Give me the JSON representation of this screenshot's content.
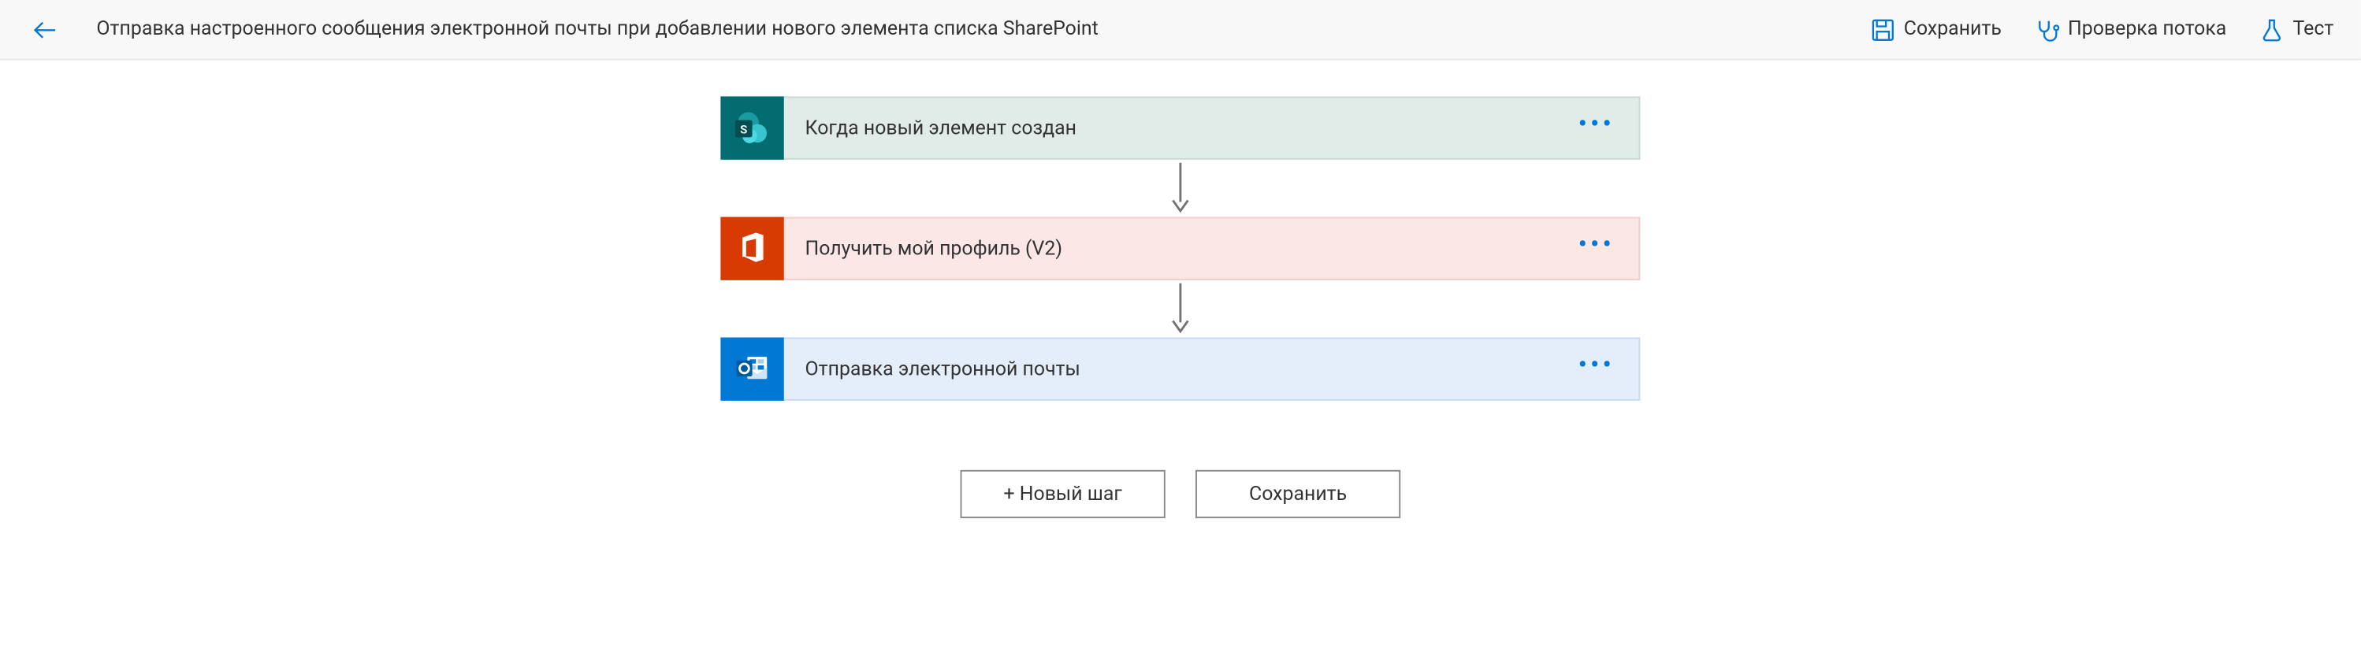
{
  "header": {
    "title": "Отправка настроенного сообщения электронной почты при добавлении нового элемента списка SharePoint",
    "actions": {
      "save": "Сохранить",
      "check_flow": "Проверка потока",
      "test": "Тест"
    }
  },
  "steps": [
    {
      "title": "Когда новый элемент создан"
    },
    {
      "title": "Получить мой профиль (V2)"
    },
    {
      "title": "Отправка электронной почты"
    }
  ],
  "buttons": {
    "new_step": "+ Новый шаг",
    "save": "Сохранить"
  }
}
